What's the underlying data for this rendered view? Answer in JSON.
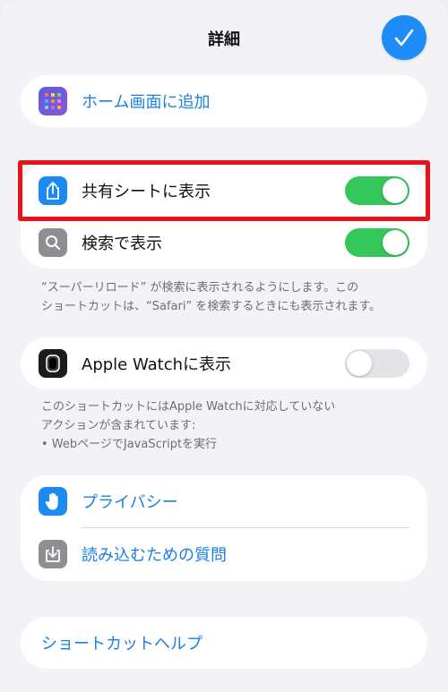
{
  "header": {
    "title": "詳細"
  },
  "add_home": {
    "label": "ホーム画面に追加"
  },
  "share_sheet": {
    "label": "共有シートに表示",
    "enabled": true
  },
  "search": {
    "label": "検索で表示",
    "enabled": true,
    "note_line1": "“スーパーリロード” が検索に表示されるようにします。この",
    "note_line2": "ショートカットは、“Safari” を検索するときにも表示されます。"
  },
  "apple_watch": {
    "label": "Apple Watchに表示",
    "enabled": false,
    "note_line1": "このショートカットにはApple Watchに対応していない",
    "note_line2": "アクションが含まれています:",
    "note_line3": "• WebページでJavaScriptを実行"
  },
  "privacy": {
    "label": "プライバシー"
  },
  "import_questions": {
    "label": "読み込むための質問"
  },
  "help": {
    "label": "ショートカットヘルプ"
  },
  "colors": {
    "accent": "#1c7fe6",
    "toggle_on": "#34c759",
    "highlight": "#e8121a"
  }
}
